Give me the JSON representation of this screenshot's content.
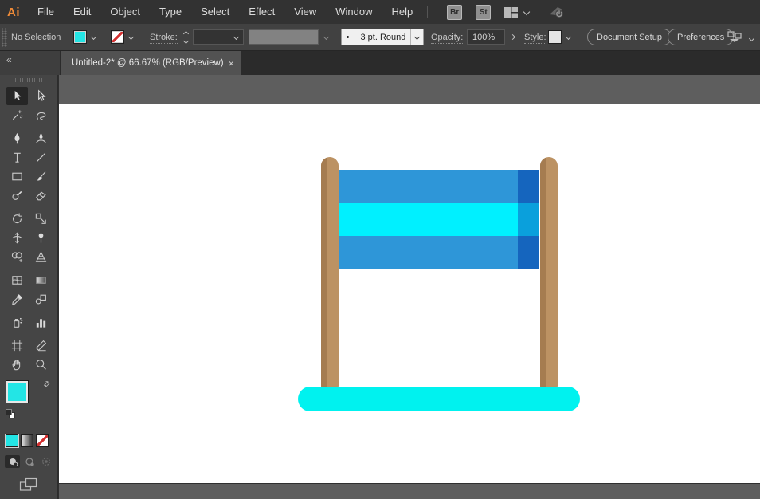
{
  "menubar": {
    "logo": "Ai",
    "items": [
      "File",
      "Edit",
      "Object",
      "Type",
      "Select",
      "Effect",
      "View",
      "Window",
      "Help"
    ],
    "bridge_button": "Br",
    "stock_button": "St"
  },
  "controlbar": {
    "selection_status": "No Selection",
    "stroke_label": "Stroke:",
    "brush_preview_dot": "•",
    "brush_value": "3 pt. Round",
    "opacity_label": "Opacity:",
    "opacity_value": "100%",
    "style_label": "Style:",
    "document_setup_button": "Document Setup",
    "preferences_button": "Preferences"
  },
  "tabbar": {
    "collapse_glyph": "«",
    "title": "Untitled-2* @ 66.67% (RGB/Preview)",
    "close_glyph": "×"
  },
  "toolbar": {
    "selected_tool": "selection",
    "swap_glyph": "⇄",
    "groups": [
      [
        [
          "selection",
          "direct-selection"
        ],
        [
          "magic-wand",
          "lasso"
        ]
      ],
      [
        [
          "pen",
          "curvature"
        ],
        [
          "type",
          "line-segment"
        ],
        [
          "rectangle",
          "paintbrush"
        ],
        [
          "shaper",
          "eraser"
        ]
      ],
      [
        [
          "rotate",
          "scale"
        ],
        [
          "width",
          "puppet-warp"
        ],
        [
          "shape-builder",
          "perspective-grid"
        ]
      ],
      [
        [
          "mesh",
          "gradient"
        ],
        [
          "eyedropper",
          "blend"
        ]
      ],
      [
        [
          "symbol-sprayer",
          "column-graph"
        ]
      ],
      [
        [
          "artboard",
          "slice"
        ],
        [
          "hand",
          "zoom"
        ]
      ]
    ]
  },
  "colors": {
    "fill_swatch": "#23E5E5",
    "style_swatch": "#E4E4E4"
  },
  "artwork": {
    "banner_stripes": [
      "#2E96D8",
      "#00F0FF",
      "#2E96D8"
    ],
    "banner_shade": [
      "#1565BE",
      "#0AA0DC",
      "#1565BE"
    ],
    "post_light": "#BC9263",
    "post_dark": "#A57C50",
    "base_color": "#00F2EF"
  }
}
